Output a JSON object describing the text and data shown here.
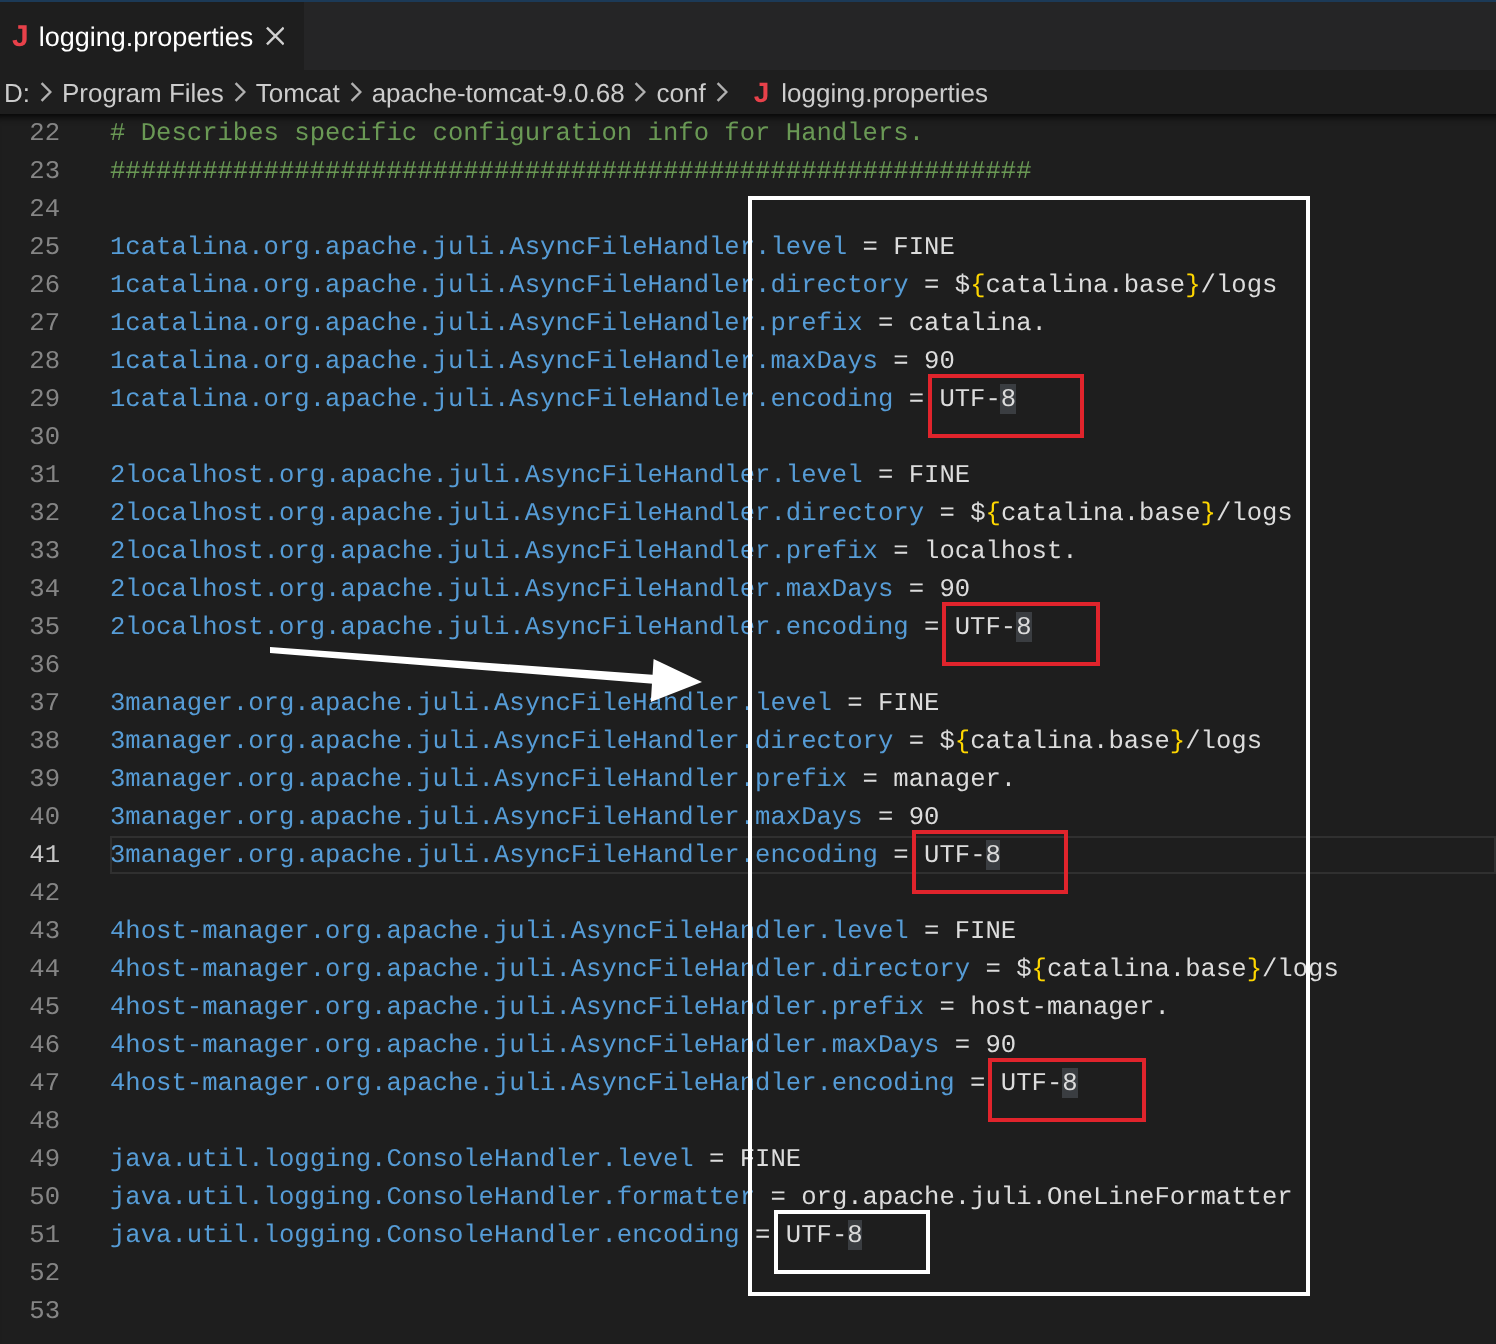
{
  "tabs": [
    {
      "icon_glyph": "J",
      "title": "logging.properties",
      "selected": true
    }
  ],
  "breadcrumb": [
    {
      "label": "D:"
    },
    {
      "label": "Program Files"
    },
    {
      "label": "Tomcat"
    },
    {
      "label": "apache-tomcat-9.0.68"
    },
    {
      "label": "conf"
    },
    {
      "icon_glyph": "J",
      "label": "logging.properties"
    }
  ],
  "editor": {
    "lines": [
      {
        "number": "22",
        "current": false,
        "tokens": [
          {
            "kind": "comment",
            "text": "# Describes specific configuration info for Handlers."
          }
        ]
      },
      {
        "number": "23",
        "current": false,
        "tokens": [
          {
            "kind": "comment",
            "text": "############################################################"
          }
        ]
      },
      {
        "number": "24",
        "current": false
      },
      {
        "number": "25",
        "current": false,
        "tokens": [
          {
            "kind": "key",
            "text": "1catalina.org.apache.juli.AsyncFileHandler.level"
          },
          {
            "kind": "op",
            "text": " = "
          },
          {
            "kind": "value",
            "text": "FINE"
          }
        ]
      },
      {
        "number": "26",
        "current": false,
        "tokens": [
          {
            "kind": "key",
            "text": "1catalina.org.apache.juli.AsyncFileHandler.directory"
          },
          {
            "kind": "op",
            "text": " = "
          },
          {
            "kind": "value",
            "text": "$"
          },
          {
            "kind": "brace",
            "text": "{"
          },
          {
            "kind": "value",
            "text": "catalina.base"
          },
          {
            "kind": "brace",
            "text": "}"
          },
          {
            "kind": "value",
            "text": "/logs"
          }
        ]
      },
      {
        "number": "27",
        "current": false,
        "tokens": [
          {
            "kind": "key",
            "text": "1catalina.org.apache.juli.AsyncFileHandler.prefix"
          },
          {
            "kind": "op",
            "text": " = "
          },
          {
            "kind": "value",
            "text": "catalina."
          }
        ]
      },
      {
        "number": "28",
        "current": false,
        "tokens": [
          {
            "kind": "key",
            "text": "1catalina.org.apache.juli.AsyncFileHandler.maxDays"
          },
          {
            "kind": "op",
            "text": " = "
          },
          {
            "kind": "value",
            "text": "90"
          }
        ]
      },
      {
        "number": "29",
        "current": false,
        "box": {
          "color": "#e0242c"
        },
        "tokens": [
          {
            "kind": "key",
            "text": "1catalina.org.apache.juli.AsyncFileHandler.encoding"
          },
          {
            "kind": "op",
            "text": " = "
          },
          {
            "kind": "value",
            "text": "UTF-"
          },
          {
            "kind": "match",
            "text": "8"
          }
        ]
      },
      {
        "number": "30",
        "current": false
      },
      {
        "number": "31",
        "current": false,
        "tokens": [
          {
            "kind": "key",
            "text": "2localhost.org.apache.juli.AsyncFileHandler.level"
          },
          {
            "kind": "op",
            "text": " = "
          },
          {
            "kind": "value",
            "text": "FINE"
          }
        ]
      },
      {
        "number": "32",
        "current": false,
        "tokens": [
          {
            "kind": "key",
            "text": "2localhost.org.apache.juli.AsyncFileHandler.directory"
          },
          {
            "kind": "op",
            "text": " = "
          },
          {
            "kind": "value",
            "text": "$"
          },
          {
            "kind": "brace",
            "text": "{"
          },
          {
            "kind": "value",
            "text": "catalina.base"
          },
          {
            "kind": "brace",
            "text": "}"
          },
          {
            "kind": "value",
            "text": "/logs"
          }
        ]
      },
      {
        "number": "33",
        "current": false,
        "tokens": [
          {
            "kind": "key",
            "text": "2localhost.org.apache.juli.AsyncFileHandler.prefix"
          },
          {
            "kind": "op",
            "text": " = "
          },
          {
            "kind": "value",
            "text": "localhost."
          }
        ]
      },
      {
        "number": "34",
        "current": false,
        "tokens": [
          {
            "kind": "key",
            "text": "2localhost.org.apache.juli.AsyncFileHandler.maxDays"
          },
          {
            "kind": "op",
            "text": " = "
          },
          {
            "kind": "value",
            "text": "90"
          }
        ]
      },
      {
        "number": "35",
        "current": false,
        "box": {
          "color": "#e0242c"
        },
        "tokens": [
          {
            "kind": "key",
            "text": "2localhost.org.apache.juli.AsyncFileHandler.encoding"
          },
          {
            "kind": "op",
            "text": " = "
          },
          {
            "kind": "value",
            "text": "UTF-"
          },
          {
            "kind": "match",
            "text": "8"
          }
        ]
      },
      {
        "number": "36",
        "current": false
      },
      {
        "number": "37",
        "current": false,
        "tokens": [
          {
            "kind": "key",
            "text": "3manager.org.apache.juli.AsyncFileHandler.level"
          },
          {
            "kind": "op",
            "text": " = "
          },
          {
            "kind": "value",
            "text": "FINE"
          }
        ]
      },
      {
        "number": "38",
        "current": false,
        "tokens": [
          {
            "kind": "key",
            "text": "3manager.org.apache.juli.AsyncFileHandler.directory"
          },
          {
            "kind": "op",
            "text": " = "
          },
          {
            "kind": "value",
            "text": "$"
          },
          {
            "kind": "brace",
            "text": "{"
          },
          {
            "kind": "value",
            "text": "catalina.base"
          },
          {
            "kind": "brace",
            "text": "}"
          },
          {
            "kind": "value",
            "text": "/logs"
          }
        ]
      },
      {
        "number": "39",
        "current": false,
        "tokens": [
          {
            "kind": "key",
            "text": "3manager.org.apache.juli.AsyncFileHandler.prefix"
          },
          {
            "kind": "op",
            "text": " = "
          },
          {
            "kind": "value",
            "text": "manager."
          }
        ]
      },
      {
        "number": "40",
        "current": false,
        "tokens": [
          {
            "kind": "key",
            "text": "3manager.org.apache.juli.AsyncFileHandler.maxDays"
          },
          {
            "kind": "op",
            "text": " = "
          },
          {
            "kind": "value",
            "text": "90"
          }
        ]
      },
      {
        "number": "41",
        "current": true,
        "box": {
          "color": "#e0242c"
        },
        "tokens": [
          {
            "kind": "key",
            "text": "3manager.org.apache.juli.AsyncFileHandler.encoding"
          },
          {
            "kind": "op",
            "text": " = "
          },
          {
            "kind": "value",
            "text": "UTF-"
          },
          {
            "kind": "match",
            "text": "8"
          }
        ]
      },
      {
        "number": "42",
        "current": false
      },
      {
        "number": "43",
        "current": false,
        "tokens": [
          {
            "kind": "key",
            "text": "4host-manager.org.apache.juli.AsyncFileHandler.level"
          },
          {
            "kind": "op",
            "text": " = "
          },
          {
            "kind": "value",
            "text": "FINE"
          }
        ]
      },
      {
        "number": "44",
        "current": false,
        "tokens": [
          {
            "kind": "key",
            "text": "4host-manager.org.apache.juli.AsyncFileHandler.directory"
          },
          {
            "kind": "op",
            "text": " = "
          },
          {
            "kind": "value",
            "text": "$"
          },
          {
            "kind": "brace",
            "text": "{"
          },
          {
            "kind": "value",
            "text": "catalina.base"
          },
          {
            "kind": "brace",
            "text": "}"
          },
          {
            "kind": "value",
            "text": "/logs"
          }
        ]
      },
      {
        "number": "45",
        "current": false,
        "tokens": [
          {
            "kind": "key",
            "text": "4host-manager.org.apache.juli.AsyncFileHandler.prefix"
          },
          {
            "kind": "op",
            "text": " = "
          },
          {
            "kind": "value",
            "text": "host-manager."
          }
        ]
      },
      {
        "number": "46",
        "current": false,
        "tokens": [
          {
            "kind": "key",
            "text": "4host-manager.org.apache.juli.AsyncFileHandler.maxDays"
          },
          {
            "kind": "op",
            "text": " = "
          },
          {
            "kind": "value",
            "text": "90"
          }
        ]
      },
      {
        "number": "47",
        "current": false,
        "box": {
          "color": "#e0242c"
        },
        "tokens": [
          {
            "kind": "key",
            "text": "4host-manager.org.apache.juli.AsyncFileHandler.encoding"
          },
          {
            "kind": "op",
            "text": " = "
          },
          {
            "kind": "value",
            "text": "UTF-"
          },
          {
            "kind": "match",
            "text": "8"
          }
        ]
      },
      {
        "number": "48",
        "current": false
      },
      {
        "number": "49",
        "current": false,
        "tokens": [
          {
            "kind": "key",
            "text": "java.util.logging.ConsoleHandler.level"
          },
          {
            "kind": "op",
            "text": " = "
          },
          {
            "kind": "value",
            "text": "FINE"
          }
        ]
      },
      {
        "number": "50",
        "current": false,
        "tokens": [
          {
            "kind": "key",
            "text": "java.util.logging.ConsoleHandler.formatter"
          },
          {
            "kind": "op",
            "text": " = "
          },
          {
            "kind": "value",
            "text": "org.apache.juli.OneLineFormatter"
          }
        ]
      },
      {
        "number": "51",
        "current": false,
        "box": {
          "color": "#ffffff"
        },
        "tokens": [
          {
            "kind": "key",
            "text": "java.util.logging.ConsoleHandler.encoding"
          },
          {
            "kind": "op",
            "text": " = "
          },
          {
            "kind": "value",
            "text": "UTF-"
          },
          {
            "kind": "match",
            "text": "8"
          }
        ]
      },
      {
        "number": "52",
        "current": false
      },
      {
        "number": "53",
        "current": false
      }
    ]
  },
  "annotations": {
    "frame": true,
    "arrow": true
  }
}
